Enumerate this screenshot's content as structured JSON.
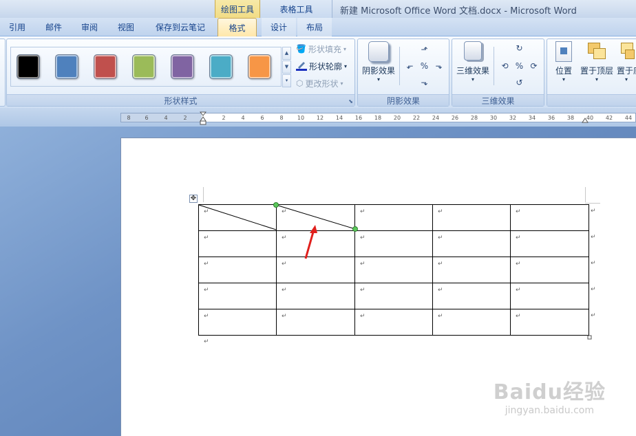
{
  "window": {
    "title": "新建 Microsoft Office Word 文档.docx - Microsoft Word"
  },
  "context_tabs": {
    "drawing_tools": "绘图工具",
    "table_tools": "表格工具"
  },
  "tabs": [
    {
      "label": "引用"
    },
    {
      "label": "邮件"
    },
    {
      "label": "审阅"
    },
    {
      "label": "视图"
    },
    {
      "label": "保存到云笔记"
    },
    {
      "label": "格式",
      "active": true
    },
    {
      "label": "设计"
    },
    {
      "label": "布局"
    }
  ],
  "shape_styles": {
    "group_label": "形状样式",
    "swatches": [
      "#000000",
      "#4f81bd",
      "#c0504d",
      "#9bbb59",
      "#8064a2",
      "#4bacc6",
      "#f79646"
    ],
    "fill_label": "形状填充",
    "outline_label": "形状轮廓",
    "change_label": "更改形状"
  },
  "shadow": {
    "button_label": "阴影效果",
    "group_label": "阴影效果"
  },
  "threed": {
    "button_label": "三维效果",
    "group_label": "三维效果"
  },
  "arrange": {
    "position_label": "位置",
    "bring_front_label": "置于顶层",
    "send_back_label": "置于底"
  },
  "ruler": {
    "ticks": [
      "8",
      "6",
      "4",
      "2",
      "2",
      "4",
      "6",
      "8",
      "10",
      "12",
      "14",
      "16",
      "18",
      "20",
      "22",
      "24",
      "26",
      "28",
      "30",
      "32",
      "34",
      "36",
      "38",
      "40",
      "42",
      "44"
    ]
  },
  "table": {
    "rows": 5,
    "cols": 5,
    "cell_mark": "↵"
  },
  "watermark": {
    "brand": "Baidu经验",
    "url": "jingyan.baidu.com"
  },
  "colors": {
    "accent_arrow": "#e0201d",
    "handle": "#4caf50"
  }
}
